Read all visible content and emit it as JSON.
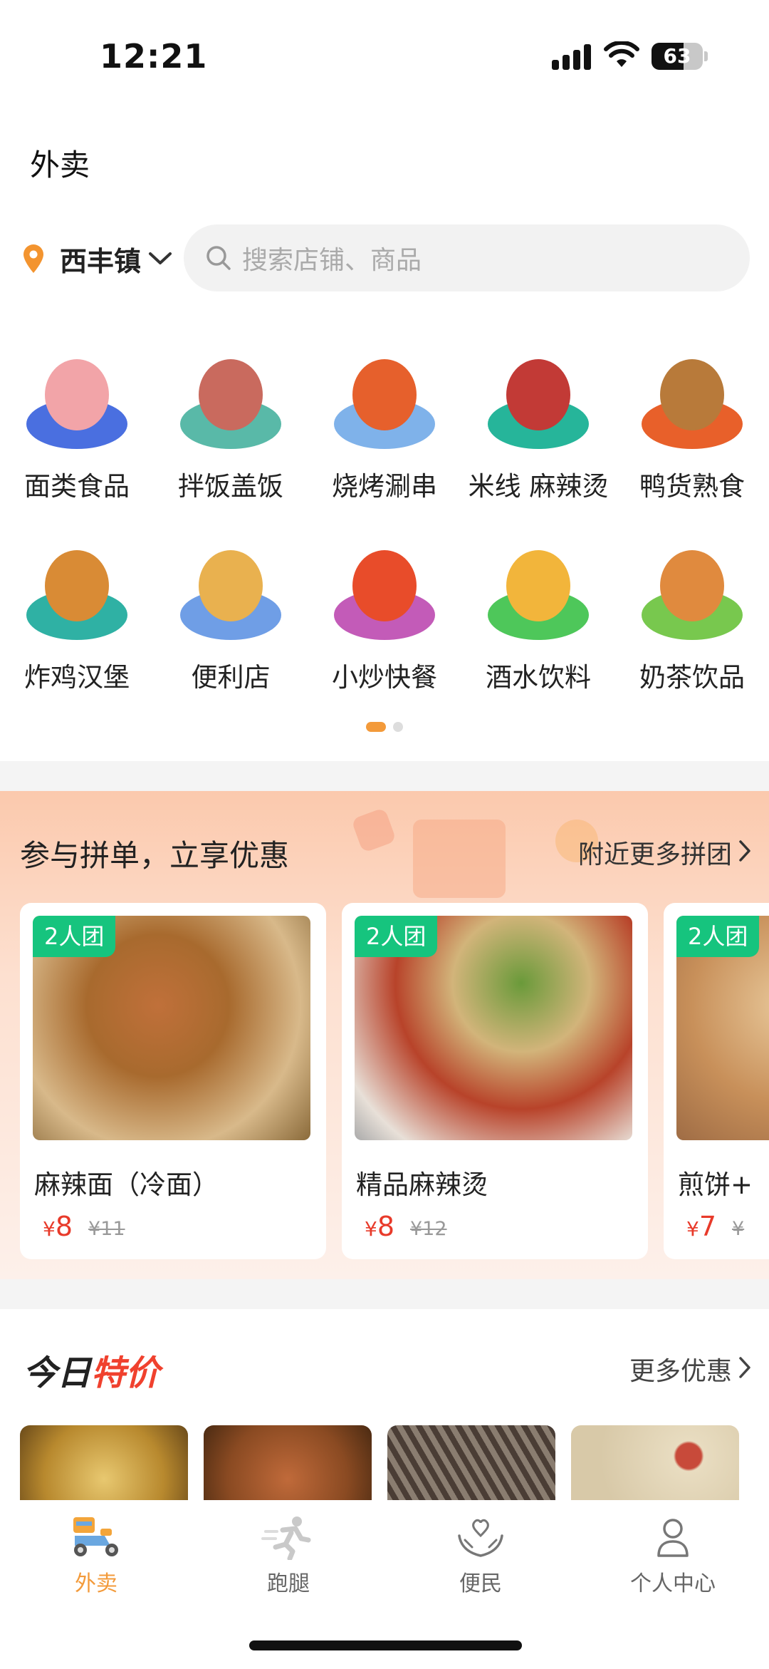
{
  "status": {
    "time": "12:21",
    "battery": "63"
  },
  "header": {
    "title": "外卖"
  },
  "location": {
    "label": "西丰镇"
  },
  "search": {
    "placeholder": "搜索店铺、商品"
  },
  "categories": [
    {
      "label": "面类食品",
      "plate": "#4a6fe0",
      "food": "#f2a4a8"
    },
    {
      "label": "拌饭盖饭",
      "plate": "#59b9a8",
      "food": "#c96a5e"
    },
    {
      "label": "烧烤涮串",
      "plate": "#7fb2ea",
      "food": "#e6602c"
    },
    {
      "label": "米线 麻辣烫",
      "plate": "#26b59a",
      "food": "#c23a36"
    },
    {
      "label": "鸭货熟食",
      "plate": "#e8602a",
      "food": "#b87a3a"
    },
    {
      "label": "炸鸡汉堡",
      "plate": "#2fb1a4",
      "food": "#d98b35"
    },
    {
      "label": "便利店",
      "plate": "#6f9ee6",
      "food": "#e9b14f"
    },
    {
      "label": "小炒快餐",
      "plate": "#c35bb8",
      "food": "#e84c2a"
    },
    {
      "label": "酒水饮料",
      "plate": "#4ec75a",
      "food": "#f2b53b"
    },
    {
      "label": "奶茶饮品",
      "plate": "#78c84e",
      "food": "#e08a3e"
    }
  ],
  "group_buy": {
    "title": "参与拼单，立享优惠",
    "more": "附近更多拼团",
    "items": [
      {
        "badge": "2人团",
        "name": "麻辣面（冷面）",
        "price": "8",
        "orig": "¥11",
        "img": "#a86a2e"
      },
      {
        "badge": "2人团",
        "name": "精品麻辣烫",
        "price": "8",
        "orig": "¥12",
        "img": "#b8432a"
      },
      {
        "badge": "2人团",
        "name": "煎饼+",
        "price": "7",
        "orig": "¥",
        "img": "#c8905a"
      }
    ]
  },
  "today": {
    "title_a": "今日",
    "title_b": "特价",
    "more": "更多优惠",
    "thumbs": [
      "#b8892e",
      "#8a4a22",
      "#6b5d55",
      "#d8c9a8"
    ]
  },
  "tabs": [
    {
      "label": "外卖",
      "active": true
    },
    {
      "label": "跑腿",
      "active": false
    },
    {
      "label": "便民",
      "active": false
    },
    {
      "label": "个人中心",
      "active": false
    }
  ],
  "colors": {
    "accent": "#f39a3a",
    "price": "#e83a2a",
    "badge": "#16c47e"
  }
}
